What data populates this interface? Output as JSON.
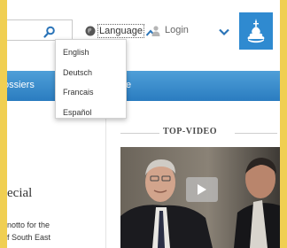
{
  "header": {
    "language_label": "Language",
    "login_label": "Login"
  },
  "language_menu": {
    "options": [
      "English",
      "Deutsch",
      "Francais",
      "Español"
    ]
  },
  "nav": {
    "item_1": "ossiers",
    "item_2": "e"
  },
  "left_column": {
    "heading_fragment": "ecial",
    "text_line_1": "notto for the",
    "text_line_2": "f South East"
  },
  "top_video": {
    "title": "TOP-VIDEO"
  },
  "colors": {
    "background": "#f0cf52",
    "nav_blue": "#3a8ccc",
    "logo_blue": "#2f8ad0",
    "icon_blue": "#2a74b8"
  },
  "icons": [
    "search-icon",
    "globe-icon",
    "chevron-up-icon",
    "person-icon",
    "chevron-down-icon",
    "logo-icon",
    "play-icon"
  ]
}
